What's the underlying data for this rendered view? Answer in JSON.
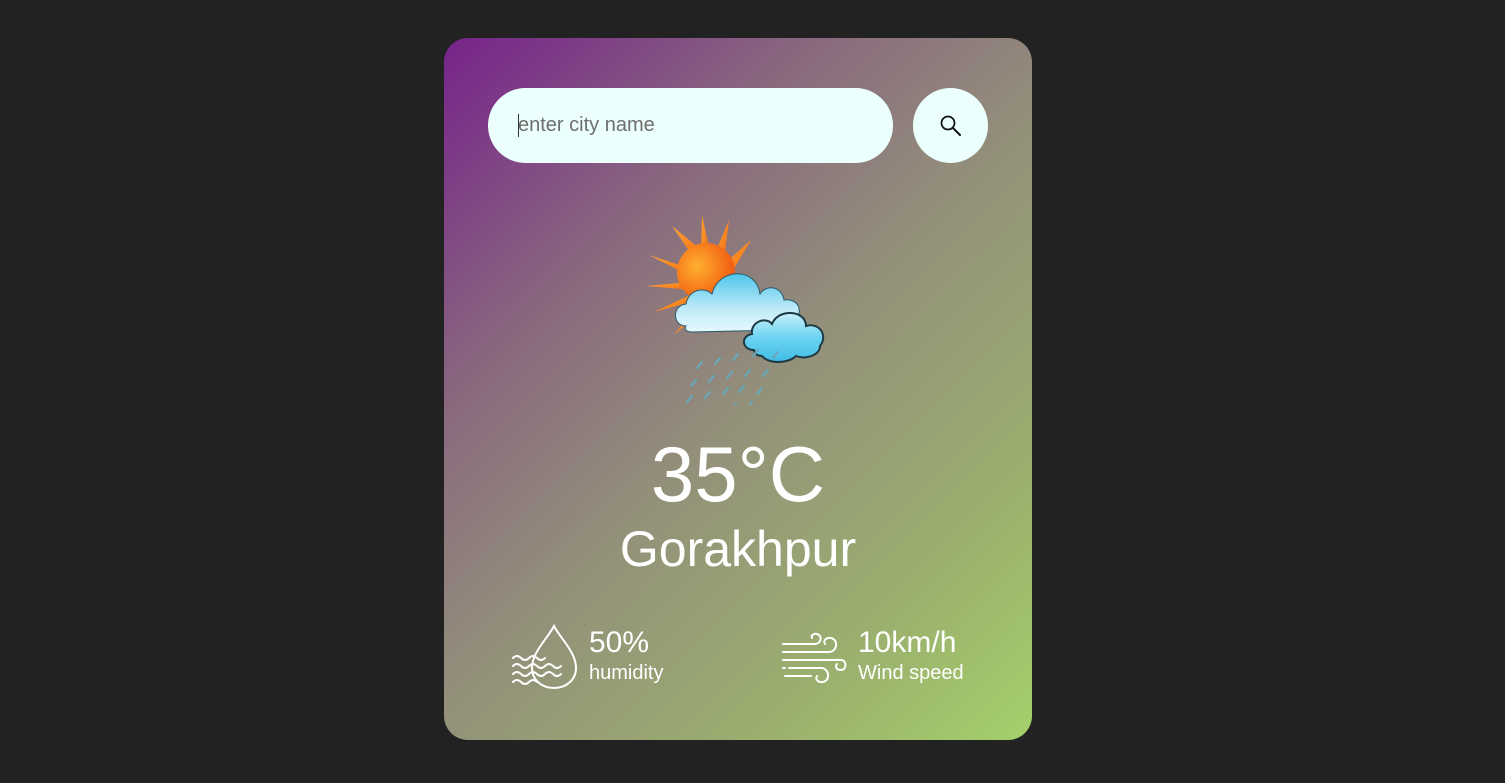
{
  "search": {
    "placeholder": "enter city name",
    "value": "",
    "button_icon": "search-icon"
  },
  "weather": {
    "icon": "sun-cloud-rain-icon",
    "temperature": "35°C",
    "city": "Gorakhpur"
  },
  "details": {
    "humidity": {
      "icon": "humidity-icon",
      "value": "50%",
      "label": "humidity"
    },
    "wind": {
      "icon": "wind-icon",
      "value": "10km/h",
      "label": "Wind speed"
    }
  },
  "colors": {
    "page_background": "#222222",
    "card_gradient_start": "#76238a",
    "card_gradient_end": "#a4d06a",
    "input_background": "#ebfffc",
    "text": "#ffffff"
  }
}
